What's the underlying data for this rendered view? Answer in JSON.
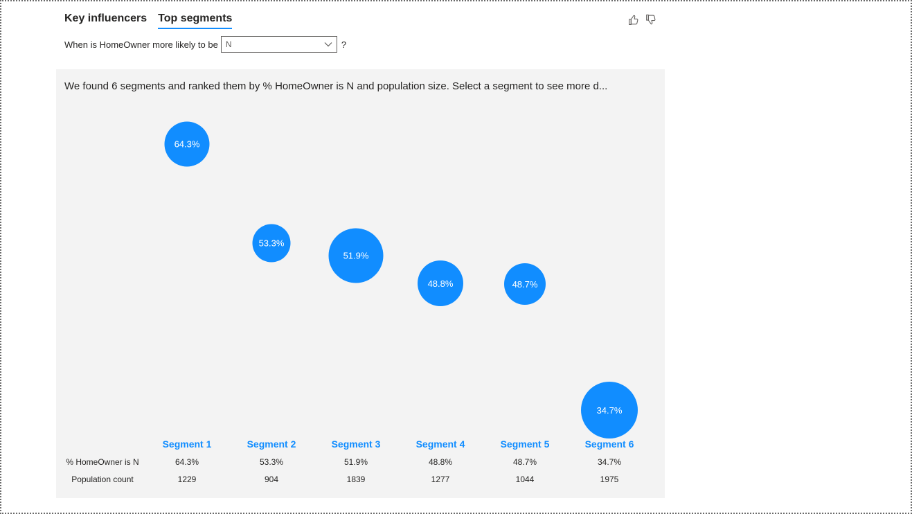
{
  "tabs": [
    {
      "label": "Key influencers",
      "active": false
    },
    {
      "label": "Top segments",
      "active": true
    }
  ],
  "feedback": {
    "like_icon": "thumbs-up-icon",
    "dislike_icon": "thumbs-down-icon"
  },
  "question": {
    "prefix": "When is HomeOwner more likely to be",
    "selected_value": "N",
    "suffix": "?"
  },
  "summary": "We found 6 segments and ranked them by % HomeOwner is N and population size. Select a segment to see more d...",
  "colors": {
    "accent": "#118dff",
    "panel_bg": "#f3f3f3"
  },
  "table": {
    "row_labels": [
      "% HomeOwner is N",
      "Population count"
    ]
  },
  "segments": [
    {
      "name": "Segment 1",
      "pct": "64.3%",
      "pct_value": 64.3,
      "population": "1229",
      "population_value": 1229
    },
    {
      "name": "Segment 2",
      "pct": "53.3%",
      "pct_value": 53.3,
      "population": "904",
      "population_value": 904
    },
    {
      "name": "Segment 3",
      "pct": "51.9%",
      "pct_value": 51.9,
      "population": "1839",
      "population_value": 1839
    },
    {
      "name": "Segment 4",
      "pct": "48.8%",
      "pct_value": 48.8,
      "population": "1277",
      "population_value": 1277
    },
    {
      "name": "Segment 5",
      "pct": "48.7%",
      "pct_value": 48.7,
      "population": "1044",
      "population_value": 1044
    },
    {
      "name": "Segment 6",
      "pct": "34.7%",
      "pct_value": 34.7,
      "population": "1975",
      "population_value": 1975
    }
  ]
}
